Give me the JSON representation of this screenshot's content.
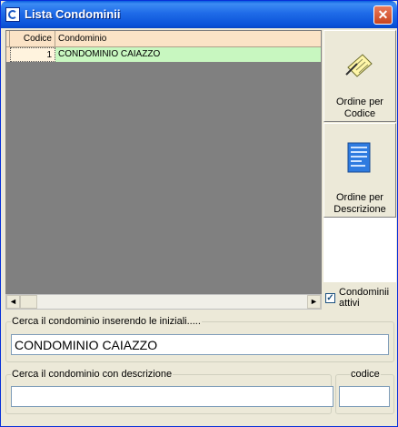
{
  "window": {
    "title": "Lista Condominii",
    "close_symbol": "✕"
  },
  "grid": {
    "columns": [
      "Codice",
      "Condominio"
    ],
    "rows": [
      {
        "codice": "1",
        "condominio": "CONDOMINIO CAIAZZO"
      }
    ],
    "colors": {
      "header": "#FBE3C6",
      "selected_row": "#C8F7C0",
      "empty_area": "#808080"
    }
  },
  "buttons": {
    "order_code": {
      "line1": "Ordine per",
      "line2": "Codice"
    },
    "order_desc": {
      "line1": "Ordine per",
      "line2": "Descrizione"
    }
  },
  "checkbox": {
    "label_line1": "Condominii",
    "label_line2": "attivi",
    "checked": true,
    "check_glyph": "✓"
  },
  "search_initials": {
    "label": "Cerca il condominio inserendo le iniziali.....",
    "value": "CONDOMINIO CAIAZZO"
  },
  "search_description": {
    "label": "Cerca il condominio con descrizione",
    "value": "",
    "code_label": "codice",
    "code_value": ""
  },
  "scrollbar": {
    "left_arrow": "◄",
    "right_arrow": "►"
  }
}
